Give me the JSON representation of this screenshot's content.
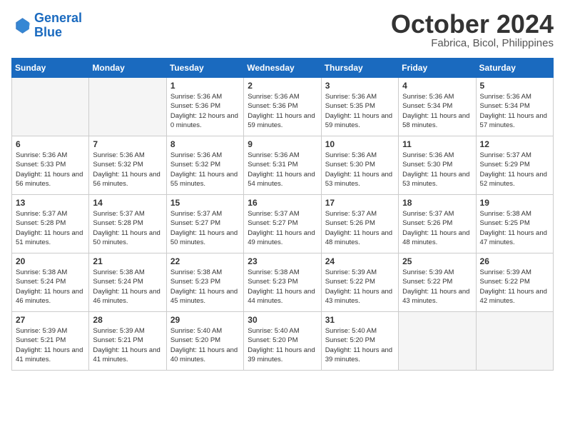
{
  "header": {
    "logo_line1": "General",
    "logo_line2": "Blue",
    "month": "October 2024",
    "location": "Fabrica, Bicol, Philippines"
  },
  "days_of_week": [
    "Sunday",
    "Monday",
    "Tuesday",
    "Wednesday",
    "Thursday",
    "Friday",
    "Saturday"
  ],
  "weeks": [
    [
      {
        "day": "",
        "info": ""
      },
      {
        "day": "",
        "info": ""
      },
      {
        "day": "1",
        "info": "Sunrise: 5:36 AM\nSunset: 5:36 PM\nDaylight: 12 hours and 0 minutes."
      },
      {
        "day": "2",
        "info": "Sunrise: 5:36 AM\nSunset: 5:36 PM\nDaylight: 11 hours and 59 minutes."
      },
      {
        "day": "3",
        "info": "Sunrise: 5:36 AM\nSunset: 5:35 PM\nDaylight: 11 hours and 59 minutes."
      },
      {
        "day": "4",
        "info": "Sunrise: 5:36 AM\nSunset: 5:34 PM\nDaylight: 11 hours and 58 minutes."
      },
      {
        "day": "5",
        "info": "Sunrise: 5:36 AM\nSunset: 5:34 PM\nDaylight: 11 hours and 57 minutes."
      }
    ],
    [
      {
        "day": "6",
        "info": "Sunrise: 5:36 AM\nSunset: 5:33 PM\nDaylight: 11 hours and 56 minutes."
      },
      {
        "day": "7",
        "info": "Sunrise: 5:36 AM\nSunset: 5:32 PM\nDaylight: 11 hours and 56 minutes."
      },
      {
        "day": "8",
        "info": "Sunrise: 5:36 AM\nSunset: 5:32 PM\nDaylight: 11 hours and 55 minutes."
      },
      {
        "day": "9",
        "info": "Sunrise: 5:36 AM\nSunset: 5:31 PM\nDaylight: 11 hours and 54 minutes."
      },
      {
        "day": "10",
        "info": "Sunrise: 5:36 AM\nSunset: 5:30 PM\nDaylight: 11 hours and 53 minutes."
      },
      {
        "day": "11",
        "info": "Sunrise: 5:36 AM\nSunset: 5:30 PM\nDaylight: 11 hours and 53 minutes."
      },
      {
        "day": "12",
        "info": "Sunrise: 5:37 AM\nSunset: 5:29 PM\nDaylight: 11 hours and 52 minutes."
      }
    ],
    [
      {
        "day": "13",
        "info": "Sunrise: 5:37 AM\nSunset: 5:28 PM\nDaylight: 11 hours and 51 minutes."
      },
      {
        "day": "14",
        "info": "Sunrise: 5:37 AM\nSunset: 5:28 PM\nDaylight: 11 hours and 50 minutes."
      },
      {
        "day": "15",
        "info": "Sunrise: 5:37 AM\nSunset: 5:27 PM\nDaylight: 11 hours and 50 minutes."
      },
      {
        "day": "16",
        "info": "Sunrise: 5:37 AM\nSunset: 5:27 PM\nDaylight: 11 hours and 49 minutes."
      },
      {
        "day": "17",
        "info": "Sunrise: 5:37 AM\nSunset: 5:26 PM\nDaylight: 11 hours and 48 minutes."
      },
      {
        "day": "18",
        "info": "Sunrise: 5:37 AM\nSunset: 5:26 PM\nDaylight: 11 hours and 48 minutes."
      },
      {
        "day": "19",
        "info": "Sunrise: 5:38 AM\nSunset: 5:25 PM\nDaylight: 11 hours and 47 minutes."
      }
    ],
    [
      {
        "day": "20",
        "info": "Sunrise: 5:38 AM\nSunset: 5:24 PM\nDaylight: 11 hours and 46 minutes."
      },
      {
        "day": "21",
        "info": "Sunrise: 5:38 AM\nSunset: 5:24 PM\nDaylight: 11 hours and 46 minutes."
      },
      {
        "day": "22",
        "info": "Sunrise: 5:38 AM\nSunset: 5:23 PM\nDaylight: 11 hours and 45 minutes."
      },
      {
        "day": "23",
        "info": "Sunrise: 5:38 AM\nSunset: 5:23 PM\nDaylight: 11 hours and 44 minutes."
      },
      {
        "day": "24",
        "info": "Sunrise: 5:39 AM\nSunset: 5:22 PM\nDaylight: 11 hours and 43 minutes."
      },
      {
        "day": "25",
        "info": "Sunrise: 5:39 AM\nSunset: 5:22 PM\nDaylight: 11 hours and 43 minutes."
      },
      {
        "day": "26",
        "info": "Sunrise: 5:39 AM\nSunset: 5:22 PM\nDaylight: 11 hours and 42 minutes."
      }
    ],
    [
      {
        "day": "27",
        "info": "Sunrise: 5:39 AM\nSunset: 5:21 PM\nDaylight: 11 hours and 41 minutes."
      },
      {
        "day": "28",
        "info": "Sunrise: 5:39 AM\nSunset: 5:21 PM\nDaylight: 11 hours and 41 minutes."
      },
      {
        "day": "29",
        "info": "Sunrise: 5:40 AM\nSunset: 5:20 PM\nDaylight: 11 hours and 40 minutes."
      },
      {
        "day": "30",
        "info": "Sunrise: 5:40 AM\nSunset: 5:20 PM\nDaylight: 11 hours and 39 minutes."
      },
      {
        "day": "31",
        "info": "Sunrise: 5:40 AM\nSunset: 5:20 PM\nDaylight: 11 hours and 39 minutes."
      },
      {
        "day": "",
        "info": ""
      },
      {
        "day": "",
        "info": ""
      }
    ]
  ]
}
